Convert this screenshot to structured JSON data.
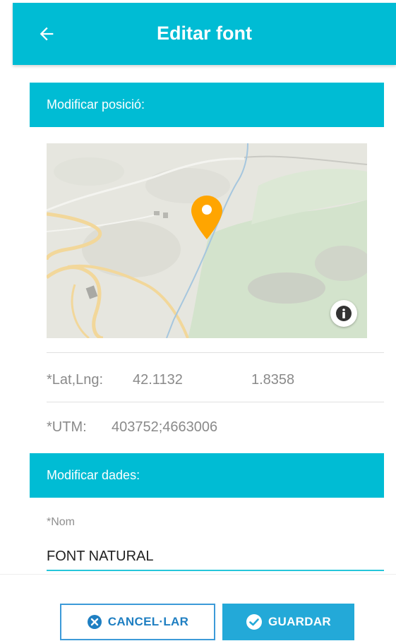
{
  "header": {
    "title": "Editar font",
    "back_icon": "arrow-left-icon"
  },
  "position_section": {
    "title": "Modificar posició:"
  },
  "map": {
    "marker_icon": "map-marker-icon",
    "info_icon": "info-icon",
    "marker_color": "#ffa500"
  },
  "coordinates": {
    "latlng_label": "*Lat,Lng:",
    "lat": "42.1132",
    "lng": "1.8358",
    "utm_label": "*UTM:",
    "utm": "403752;4663006"
  },
  "data_section": {
    "title": "Modificar dades:"
  },
  "form": {
    "name_label": "*Nom",
    "name_value": "FONT NATURAL"
  },
  "actions": {
    "cancel_label": "CANCEL·LAR",
    "cancel_icon": "x-circle-icon",
    "save_label": "GUARDAR",
    "save_icon": "check-circle-icon"
  },
  "colors": {
    "primary": "#00bcd4",
    "button_blue": "#23a9d8",
    "accent_line": "#26c6da"
  }
}
